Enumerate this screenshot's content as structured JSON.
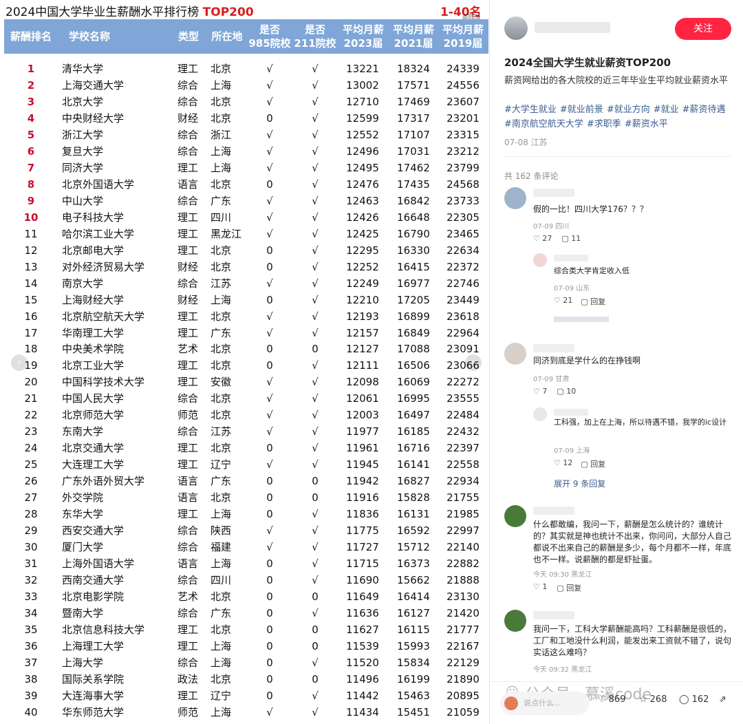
{
  "left": {
    "title": "2024中国大学毕业生薪酬水平排行榜",
    "title_highlight": "TOP200",
    "title_right": "1-40名",
    "counter": "1/5",
    "headers": {
      "rank": "薪酬排名",
      "name": "学校名称",
      "type": "类型",
      "loc": "所在地",
      "c985": "是否\n985院校",
      "c211": "是否\n211院校",
      "s2023": "平均月薪\n2023届",
      "s2021": "平均月薪\n2021届",
      "s2019": "平均月薪\n2019届"
    },
    "rows": [
      {
        "rank": "1",
        "name": "清华大学",
        "type": "理工",
        "loc": "北京",
        "c985": "√",
        "c211": "√",
        "s2023": "13221",
        "s2021": "18324",
        "s2019": "24339"
      },
      {
        "rank": "2",
        "name": "上海交通大学",
        "type": "综合",
        "loc": "上海",
        "c985": "√",
        "c211": "√",
        "s2023": "13002",
        "s2021": "17571",
        "s2019": "24556"
      },
      {
        "rank": "3",
        "name": "北京大学",
        "type": "综合",
        "loc": "北京",
        "c985": "√",
        "c211": "√",
        "s2023": "12710",
        "s2021": "17469",
        "s2019": "23607"
      },
      {
        "rank": "4",
        "name": "中央财经大学",
        "type": "财经",
        "loc": "北京",
        "c985": "0",
        "c211": "√",
        "s2023": "12599",
        "s2021": "17317",
        "s2019": "23201"
      },
      {
        "rank": "5",
        "name": "浙江大学",
        "type": "综合",
        "loc": "浙江",
        "c985": "√",
        "c211": "√",
        "s2023": "12552",
        "s2021": "17107",
        "s2019": "23315"
      },
      {
        "rank": "6",
        "name": "复旦大学",
        "type": "综合",
        "loc": "上海",
        "c985": "√",
        "c211": "√",
        "s2023": "12496",
        "s2021": "17031",
        "s2019": "23212"
      },
      {
        "rank": "7",
        "name": "同济大学",
        "type": "理工",
        "loc": "上海",
        "c985": "√",
        "c211": "√",
        "s2023": "12495",
        "s2021": "17462",
        "s2019": "23799"
      },
      {
        "rank": "8",
        "name": "北京外国语大学",
        "type": "语言",
        "loc": "北京",
        "c985": "0",
        "c211": "√",
        "s2023": "12476",
        "s2021": "17435",
        "s2019": "24568"
      },
      {
        "rank": "9",
        "name": "中山大学",
        "type": "综合",
        "loc": "广东",
        "c985": "√",
        "c211": "√",
        "s2023": "12463",
        "s2021": "16842",
        "s2019": "23733"
      },
      {
        "rank": "10",
        "name": "电子科技大学",
        "type": "理工",
        "loc": "四川",
        "c985": "√",
        "c211": "√",
        "s2023": "12426",
        "s2021": "16648",
        "s2019": "22305"
      },
      {
        "rank": "11",
        "name": "哈尔滨工业大学",
        "type": "理工",
        "loc": "黑龙江",
        "c985": "√",
        "c211": "√",
        "s2023": "12425",
        "s2021": "16790",
        "s2019": "23465"
      },
      {
        "rank": "12",
        "name": "北京邮电大学",
        "type": "理工",
        "loc": "北京",
        "c985": "0",
        "c211": "√",
        "s2023": "12295",
        "s2021": "16330",
        "s2019": "22634"
      },
      {
        "rank": "13",
        "name": "对外经济贸易大学",
        "type": "财经",
        "loc": "北京",
        "c985": "0",
        "c211": "√",
        "s2023": "12252",
        "s2021": "16415",
        "s2019": "22372"
      },
      {
        "rank": "14",
        "name": "南京大学",
        "type": "综合",
        "loc": "江苏",
        "c985": "√",
        "c211": "√",
        "s2023": "12249",
        "s2021": "16977",
        "s2019": "22746"
      },
      {
        "rank": "15",
        "name": "上海财经大学",
        "type": "财经",
        "loc": "上海",
        "c985": "0",
        "c211": "√",
        "s2023": "12210",
        "s2021": "17205",
        "s2019": "23449"
      },
      {
        "rank": "16",
        "name": "北京航空航天大学",
        "type": "理工",
        "loc": "北京",
        "c985": "√",
        "c211": "√",
        "s2023": "12193",
        "s2021": "16899",
        "s2019": "23618"
      },
      {
        "rank": "17",
        "name": "华南理工大学",
        "type": "理工",
        "loc": "广东",
        "c985": "√",
        "c211": "√",
        "s2023": "12157",
        "s2021": "16849",
        "s2019": "22964"
      },
      {
        "rank": "18",
        "name": "中央美术学院",
        "type": "艺术",
        "loc": "北京",
        "c985": "0",
        "c211": "0",
        "s2023": "12127",
        "s2021": "17088",
        "s2019": "23091"
      },
      {
        "rank": "19",
        "name": "北京工业大学",
        "type": "理工",
        "loc": "北京",
        "c985": "0",
        "c211": "√",
        "s2023": "12111",
        "s2021": "16506",
        "s2019": "23066"
      },
      {
        "rank": "20",
        "name": "中国科学技术大学",
        "type": "理工",
        "loc": "安徽",
        "c985": "√",
        "c211": "√",
        "s2023": "12098",
        "s2021": "16069",
        "s2019": "22272"
      },
      {
        "rank": "21",
        "name": "中国人民大学",
        "type": "综合",
        "loc": "北京",
        "c985": "√",
        "c211": "√",
        "s2023": "12061",
        "s2021": "16995",
        "s2019": "23555"
      },
      {
        "rank": "22",
        "name": "北京师范大学",
        "type": "师范",
        "loc": "北京",
        "c985": "√",
        "c211": "√",
        "s2023": "12003",
        "s2021": "16497",
        "s2019": "22484"
      },
      {
        "rank": "23",
        "name": "东南大学",
        "type": "综合",
        "loc": "江苏",
        "c985": "√",
        "c211": "√",
        "s2023": "11977",
        "s2021": "16185",
        "s2019": "22432"
      },
      {
        "rank": "24",
        "name": "北京交通大学",
        "type": "理工",
        "loc": "北京",
        "c985": "0",
        "c211": "√",
        "s2023": "11961",
        "s2021": "16716",
        "s2019": "22397"
      },
      {
        "rank": "25",
        "name": "大连理工大学",
        "type": "理工",
        "loc": "辽宁",
        "c985": "√",
        "c211": "√",
        "s2023": "11945",
        "s2021": "16141",
        "s2019": "22558"
      },
      {
        "rank": "26",
        "name": "广东外语外贸大学",
        "type": "语言",
        "loc": "广东",
        "c985": "0",
        "c211": "0",
        "s2023": "11942",
        "s2021": "16827",
        "s2019": "22934"
      },
      {
        "rank": "27",
        "name": "外交学院",
        "type": "语言",
        "loc": "北京",
        "c985": "0",
        "c211": "0",
        "s2023": "11916",
        "s2021": "15828",
        "s2019": "21755"
      },
      {
        "rank": "28",
        "name": "东华大学",
        "type": "理工",
        "loc": "上海",
        "c985": "0",
        "c211": "√",
        "s2023": "11836",
        "s2021": "16131",
        "s2019": "21985"
      },
      {
        "rank": "29",
        "name": "西安交通大学",
        "type": "综合",
        "loc": "陕西",
        "c985": "√",
        "c211": "√",
        "s2023": "11775",
        "s2021": "16592",
        "s2019": "22997"
      },
      {
        "rank": "30",
        "name": "厦门大学",
        "type": "综合",
        "loc": "福建",
        "c985": "√",
        "c211": "√",
        "s2023": "11727",
        "s2021": "15712",
        "s2019": "22140"
      },
      {
        "rank": "31",
        "name": "上海外国语大学",
        "type": "语言",
        "loc": "上海",
        "c985": "0",
        "c211": "√",
        "s2023": "11715",
        "s2021": "16373",
        "s2019": "22882"
      },
      {
        "rank": "32",
        "name": "西南交通大学",
        "type": "综合",
        "loc": "四川",
        "c985": "0",
        "c211": "√",
        "s2023": "11690",
        "s2021": "15662",
        "s2019": "21888"
      },
      {
        "rank": "33",
        "name": "北京电影学院",
        "type": "艺术",
        "loc": "北京",
        "c985": "0",
        "c211": "0",
        "s2023": "11649",
        "s2021": "16414",
        "s2019": "23130"
      },
      {
        "rank": "34",
        "name": "暨南大学",
        "type": "综合",
        "loc": "广东",
        "c985": "0",
        "c211": "√",
        "s2023": "11636",
        "s2021": "16127",
        "s2019": "21420"
      },
      {
        "rank": "35",
        "name": "北京信息科技大学",
        "type": "理工",
        "loc": "北京",
        "c985": "0",
        "c211": "0",
        "s2023": "11627",
        "s2021": "16115",
        "s2019": "21777"
      },
      {
        "rank": "36",
        "name": "上海理工大学",
        "type": "理工",
        "loc": "上海",
        "c985": "0",
        "c211": "0",
        "s2023": "11539",
        "s2021": "15993",
        "s2019": "22167"
      },
      {
        "rank": "37",
        "name": "上海大学",
        "type": "综合",
        "loc": "上海",
        "c985": "0",
        "c211": "√",
        "s2023": "11520",
        "s2021": "15834",
        "s2019": "22129"
      },
      {
        "rank": "38",
        "name": "国际关系学院",
        "type": "政法",
        "loc": "北京",
        "c985": "0",
        "c211": "0",
        "s2023": "11496",
        "s2021": "16199",
        "s2019": "21890"
      },
      {
        "rank": "39",
        "name": "大连海事大学",
        "type": "理工",
        "loc": "辽宁",
        "c985": "0",
        "c211": "√",
        "s2023": "11442",
        "s2021": "15463",
        "s2019": "20895"
      },
      {
        "rank": "40",
        "name": "华东师范大学",
        "type": "师范",
        "loc": "上海",
        "c985": "√",
        "c211": "√",
        "s2023": "11434",
        "s2021": "15451",
        "s2019": "21059"
      }
    ]
  },
  "right": {
    "follow_label": "关注",
    "post_title": "2024全国大学生就业薪资TOP200",
    "post_desc": "薪资网给出的各大院校的近三年毕业生平均就业薪资水平",
    "tags": [
      "#大学生就业",
      "#就业前景",
      "#就业方向",
      "#就业",
      "#薪资待遇",
      "#南京航空航天大学",
      "#求职季",
      "#薪资水平"
    ],
    "post_meta": "07-08 江苏",
    "comment_count": "共 162 条评论",
    "comments": [
      {
        "text": "假的一比！四川大学176？？？",
        "meta": "07-09 四川",
        "likes": "27",
        "replies": "11"
      },
      {
        "text": "同济到底是学什么的在挣钱啊",
        "meta": "07-09 甘肃",
        "likes": "7",
        "replies": "10"
      },
      {
        "text": "什么都敢编，我问一下，薪酬是怎么统计的？谁统计的？其实就是神也统计不出来，你问问，大部分人自己都说不出来自己的薪酬是多少，每个月都不一样，年底也不一样。说薪酬的都是虾扯蛋。",
        "meta": "今天 09:30 黑龙江",
        "likes": "1",
        "replies": "回复"
      },
      {
        "text": "我问一下，工科大学薪酬能高吗？工科薪酬是很低的，工厂和工地没什么利润，能发出来工资就不错了，说句实话这么难吗？",
        "meta": "今天 09:32 黑龙江"
      }
    ],
    "subcomments": [
      {
        "text": "综合类大学肯定收入低",
        "meta": "07-09 山东",
        "likes": "21",
        "replies": "回复"
      },
      {
        "text": "工科强，加上在上海，所以待遇不错，我学的ic设计",
        "meta": "07-09 上海",
        "likes": "12",
        "replies": "回复"
      }
    ],
    "expand_label": "展开 9 条回复",
    "input_placeholder": "说点什么...",
    "watermark": "公众号 · 慕溪code",
    "stats": {
      "likes": "869",
      "stars": "268",
      "comments": "162"
    }
  }
}
